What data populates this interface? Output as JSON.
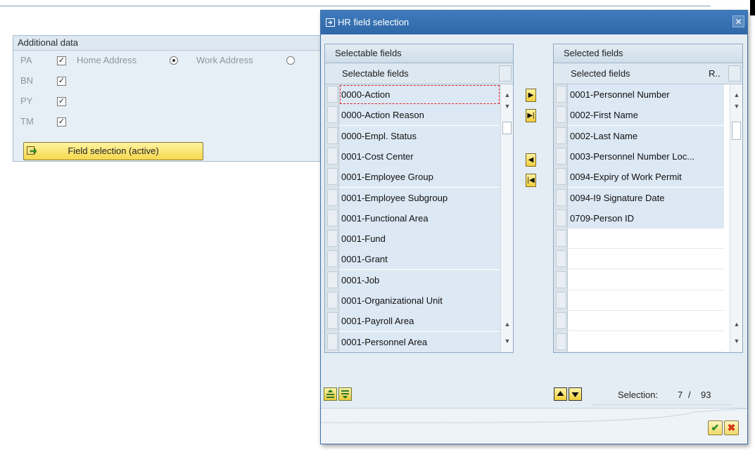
{
  "additional_data": {
    "title": "Additional data",
    "rows": [
      {
        "code": "PA",
        "checked": true
      },
      {
        "code": "BN",
        "checked": true
      },
      {
        "code": "PY",
        "checked": true
      },
      {
        "code": "TM",
        "checked": true
      }
    ],
    "address_options": [
      {
        "label": "Home Address",
        "selected": true
      },
      {
        "label": "Work Address",
        "selected": false
      }
    ],
    "field_selection_button": "Field selection (active)"
  },
  "dialog": {
    "title": "HR field selection",
    "close_icon": "close-icon",
    "selectable": {
      "panel_title": "Selectable fields",
      "column_header": "Selectable fields",
      "rows": [
        "0000-Action",
        "0000-Action Reason",
        "0000-Empl. Status",
        "0001-Cost Center",
        "0001-Employee Group",
        "0001-Employee Subgroup",
        "0001-Functional Area",
        "0001-Fund",
        "0001-Grant",
        "0001-Job",
        "0001-Organizational Unit",
        "0001-Payroll Area",
        "0001-Personnel Area"
      ]
    },
    "selected": {
      "panel_title": "Selected fields",
      "column_header": "Selected fields",
      "column_header_2": "R..",
      "rows": [
        "0001-Personnel Number",
        "0002-First Name",
        "0002-Last Name",
        "0003-Personnel Number Loc...",
        "0094-Expiry of Work Permit",
        "0094-I9 Signature Date",
        "0709-Person ID"
      ]
    },
    "move_icons": [
      "move-right-icon",
      "move-all-right-icon",
      "move-left-icon",
      "move-all-left-icon"
    ],
    "selection_label": "Selection:",
    "selection_count": "7",
    "selection_sep": "/",
    "selection_total": "93",
    "colors": {
      "title_bar": "#2f67a8",
      "panel_bg": "#e5edf4",
      "button_yellow": "#f5d84d"
    }
  }
}
